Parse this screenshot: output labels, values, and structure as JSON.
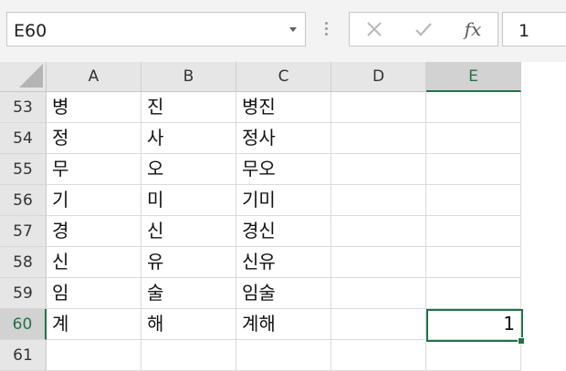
{
  "name_box": {
    "value": "E60"
  },
  "formula_bar": {
    "value": "1",
    "fx_label": "fx"
  },
  "columns": [
    {
      "label": "A",
      "selected": false
    },
    {
      "label": "B",
      "selected": false
    },
    {
      "label": "C",
      "selected": false
    },
    {
      "label": "D",
      "selected": false
    },
    {
      "label": "E",
      "selected": true
    }
  ],
  "rows": [
    {
      "num": "53",
      "cells": [
        "병",
        "진",
        "병진",
        "",
        ""
      ]
    },
    {
      "num": "54",
      "cells": [
        "정",
        "사",
        "정사",
        "",
        ""
      ]
    },
    {
      "num": "55",
      "cells": [
        "무",
        "오",
        "무오",
        "",
        ""
      ]
    },
    {
      "num": "56",
      "cells": [
        "기",
        "미",
        "기미",
        "",
        ""
      ]
    },
    {
      "num": "57",
      "cells": [
        "경",
        "신",
        "경신",
        "",
        ""
      ]
    },
    {
      "num": "58",
      "cells": [
        "신",
        "유",
        "신유",
        "",
        ""
      ]
    },
    {
      "num": "59",
      "cells": [
        "임",
        "술",
        "임술",
        "",
        ""
      ]
    },
    {
      "num": "60",
      "cells": [
        "계",
        "해",
        "계해",
        "",
        "1"
      ]
    },
    {
      "num": "61",
      "cells": [
        "",
        "",
        "",
        "",
        ""
      ]
    }
  ],
  "active_cell": {
    "ref": "E60",
    "value": "1"
  },
  "colors": {
    "accent": "#217346",
    "header_bg": "#e6e6e6",
    "gridline": "#dadada"
  }
}
